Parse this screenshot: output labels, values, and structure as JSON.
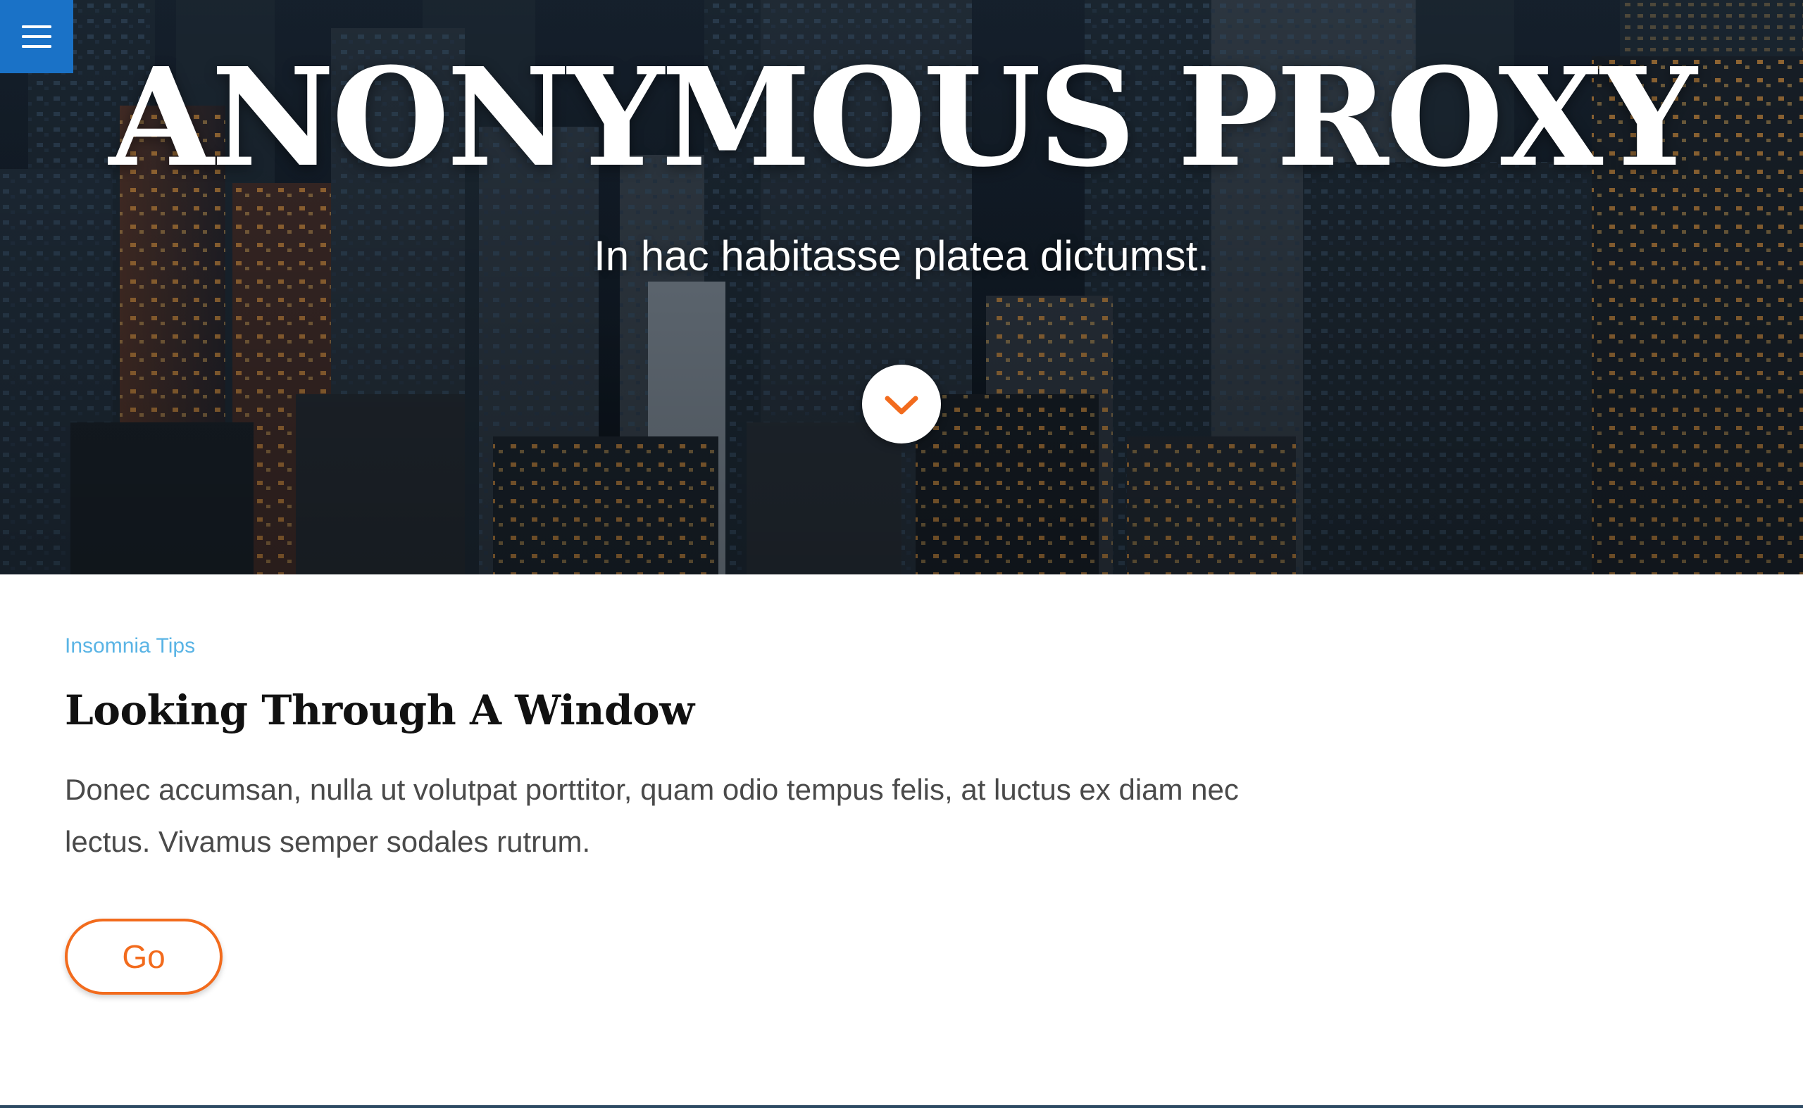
{
  "header": {
    "menu_icon": "hamburger-menu-icon",
    "menu_button_color": "#1a72c7"
  },
  "hero": {
    "title": "ANONYMOUS PROXY",
    "subtitle": "In hac habitasse platea dictumst.",
    "scroll_icon": "chevron-down-icon",
    "background_image": "city-skyline-at-dusk"
  },
  "article": {
    "category": "Insomnia Tips",
    "title": "Looking Through A Window",
    "excerpt": "Donec accumsan, nulla ut volutpat porttitor, quam odio tempus felis, at luctus ex diam nec lectus. Vivamus semper sodales rutrum.",
    "button_label": "Go"
  },
  "colors": {
    "accent": "#f26b1d",
    "link": "#5ab4e5",
    "heading": "#111111",
    "body_text": "#4a4a4a"
  }
}
